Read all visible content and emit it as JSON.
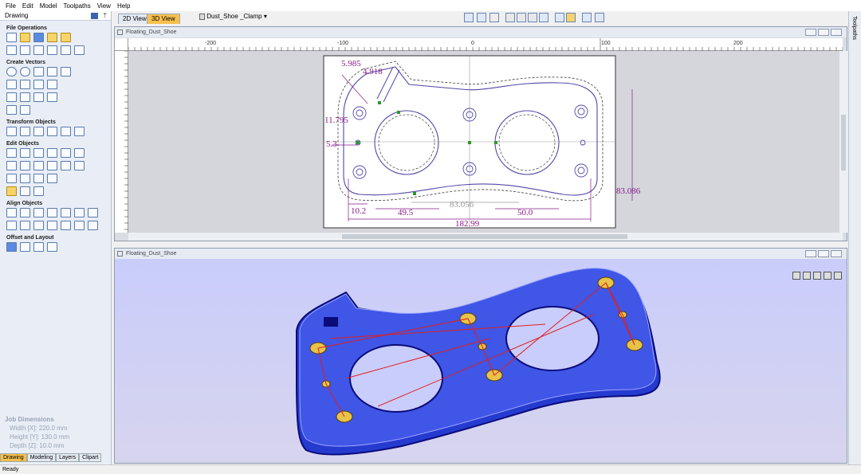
{
  "menu": [
    "File",
    "Edit",
    "Model",
    "Toolpaths",
    "View",
    "Help"
  ],
  "panel": {
    "title": "Drawing",
    "pin": "ᛘ",
    "sections": [
      "File Operations",
      "Create Vectors",
      "Transform Objects",
      "Edit Objects",
      "Align Objects",
      "Offset and Layout"
    ],
    "bottom_tabs": [
      "Drawing",
      "Modeling",
      "Layers",
      "Clipart"
    ]
  },
  "job": {
    "title": "Job Dimensions",
    "width": "Width  [X]: 220.0 mm",
    "height": "Height [Y]: 130.0 mm",
    "depth": "Depth  [Z]: 10.0 mm"
  },
  "toolbar": {
    "tab_2d": "2D View",
    "tab_3d": "3D View",
    "file_tab": "Dust_Shoe _Clamp"
  },
  "right_tab": "Toolpaths",
  "window2d": {
    "title": "Floating_Dust_Shoe",
    "ruler_labels": [
      "-200",
      "-100",
      "0",
      "100",
      "200"
    ],
    "dims": [
      "5.985",
      "4.918",
      "11.795",
      "5.3",
      "10.2",
      "49.5",
      "83.056",
      "50.0",
      "182.99",
      "83.086"
    ]
  },
  "window3d": {
    "title": "Floating_Dust_Shoe"
  },
  "status": "Ready",
  "colors": {
    "accent": "#7b1c8a",
    "toolpath": "#2a1de0",
    "rapid": "#e02020",
    "tab_active": "#f7c04d"
  }
}
